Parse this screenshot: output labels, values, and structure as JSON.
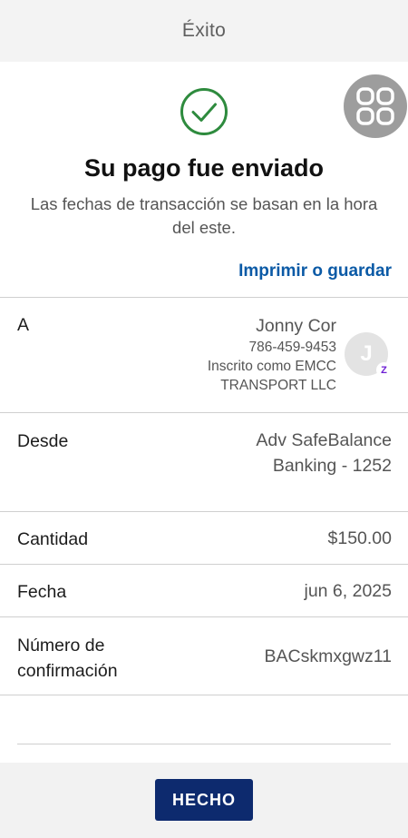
{
  "header": {
    "title": "Éxito"
  },
  "success": {
    "headline": "Su pago fue enviado",
    "note": "Las fechas de transacción se basan en la hora del este.",
    "print_link": "Imprimir o guardar"
  },
  "rows": {
    "to": {
      "label": "A",
      "name": "Jonny Cor",
      "phone": "786-459-9453",
      "enrolled": "Inscrito como EMCC TRANSPORT LLC",
      "avatar_initial": "J"
    },
    "from": {
      "label": "Desde",
      "value": "Adv SafeBalance Banking - 1252"
    },
    "amount": {
      "label": "Cantidad",
      "value": "$150.00"
    },
    "date": {
      "label": "Fecha",
      "value": "jun 6, 2025"
    },
    "confirmation": {
      "label": "Número de confirmación",
      "value": "BACskmxgwz11"
    }
  },
  "footer": {
    "done_label": "HECHO"
  },
  "colors": {
    "accent_link": "#0b5aa6",
    "primary_button": "#0d2a6e",
    "success_green": "#2e8b3e",
    "zelle_purple": "#6d1ed4"
  },
  "icons": {
    "success": "check-circle-icon",
    "apps": "apps-grid-icon",
    "payment_network": "zelle-icon"
  }
}
